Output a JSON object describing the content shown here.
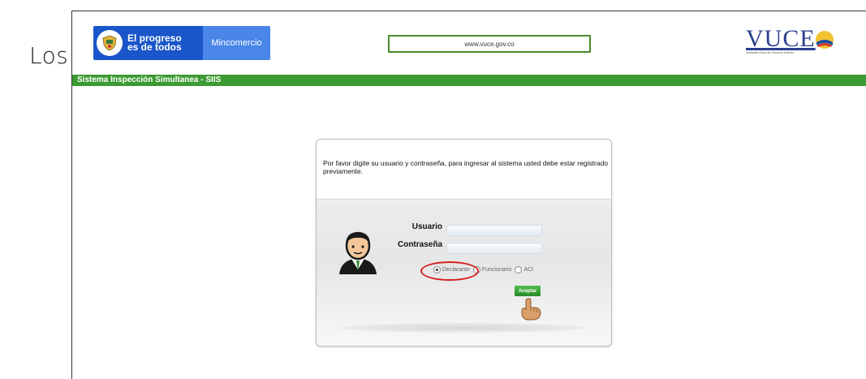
{
  "document": {
    "leading_text": "Los"
  },
  "header": {
    "gov_slogan": "El progreso es de todos",
    "gov_slogan_line1": "El progreso",
    "gov_slogan_line2": "es de todos",
    "ministry": "Mincomercio",
    "url": "www.vuce.gov.co",
    "vuce_logo_text": "VUCE",
    "vuce_subtitle": "Ventanilla Única de Comercio Exterior"
  },
  "system_bar": {
    "title": "Sistema Inspección Simultanea - SIIS"
  },
  "login": {
    "message": "Por favor digite su usuario y contraseña, para ingresar al sistema usted debe estar registrado previamente.",
    "user_label": "Usuario",
    "password_label": "Contraseña",
    "user_value": "",
    "password_value": "",
    "roles": [
      {
        "label": "Declarante",
        "selected": true
      },
      {
        "label": "Funcionario",
        "selected": false
      },
      {
        "label": "ACI",
        "selected": false
      }
    ],
    "accept_label": "Aceptar"
  },
  "colors": {
    "green_bar": "#3d9a32",
    "gov_blue": "#1a56c9",
    "ministry_blue": "#4a86e8",
    "highlight_red": "#d62020"
  },
  "icons": [
    "colombia-shield-icon",
    "user-avatar-icon",
    "pointing-hand-icon",
    "vuce-sun-icon"
  ]
}
